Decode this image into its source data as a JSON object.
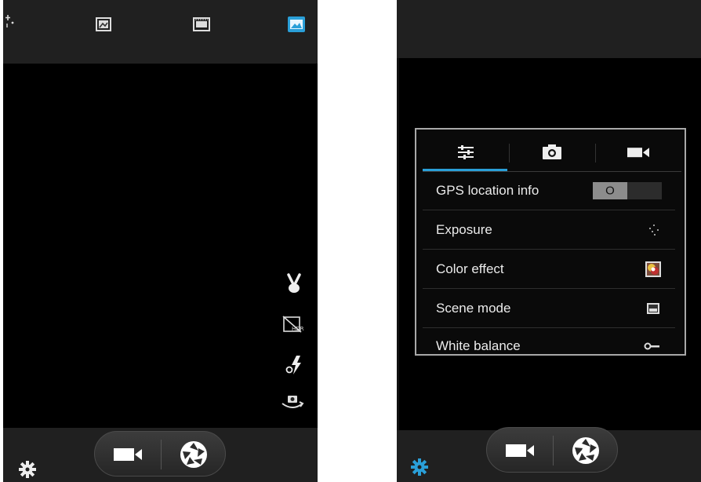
{
  "left_screen": {
    "top_icons": [
      "flash-sparkle-icon",
      "panorama-icon",
      "video-mode-icon",
      "photo-mode-icon"
    ],
    "side_icons": [
      "scene-hand-icon",
      "hdr-off-icon",
      "flash-auto-icon",
      "switch-camera-icon"
    ],
    "bottom": {
      "settings_icon": "gear-icon",
      "buttons": [
        "video-camera-icon",
        "shutter-icon"
      ]
    }
  },
  "right_screen": {
    "settings_panel": {
      "tabs": [
        {
          "icon": "sliders-icon",
          "selected": true
        },
        {
          "icon": "camera-icon",
          "selected": false
        },
        {
          "icon": "video-camera-icon",
          "selected": false
        }
      ],
      "rows": [
        {
          "label": "GPS location info",
          "control": "toggle",
          "toggle_state": "O"
        },
        {
          "label": "Exposure",
          "icon": "exposure-icon"
        },
        {
          "label": "Color effect",
          "icon": "color-effect-icon"
        },
        {
          "label": "Scene mode",
          "icon": "scene-mode-icon"
        },
        {
          "label": "White balance",
          "icon": "white-balance-icon"
        }
      ]
    },
    "bottom": {
      "settings_icon": "gear-icon",
      "buttons": [
        "video-camera-icon",
        "shutter-icon"
      ]
    }
  },
  "colors": {
    "accent": "#2a9fd8",
    "background": "#000000",
    "bar": "#202020"
  }
}
